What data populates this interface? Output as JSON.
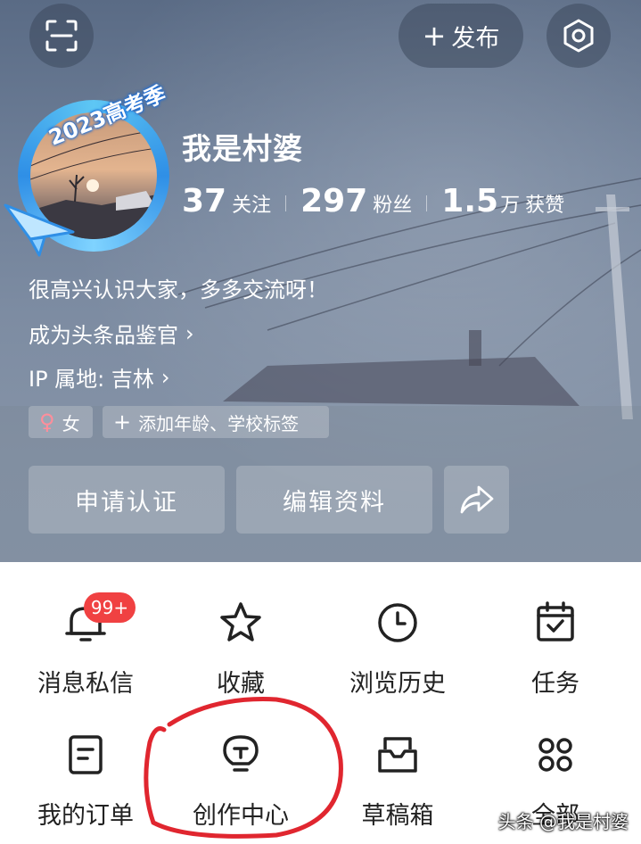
{
  "header": {
    "scan_icon": "scan-icon",
    "publish_label": "发布",
    "settings_icon": "settings-icon"
  },
  "profile": {
    "avatar_badge": "2023高考季",
    "username": "我是村婆",
    "stats": [
      {
        "value": "37",
        "unit": "",
        "label": "关注"
      },
      {
        "value": "297",
        "unit": "",
        "label": "粉丝"
      },
      {
        "value": "1.5",
        "unit": "万",
        "label": "获赞"
      }
    ],
    "bio": "很高兴认识大家，多多交流呀！",
    "appraiser_link": "成为头条品鉴官",
    "ip_location": "IP 属地: 吉林",
    "tags": {
      "gender": "女",
      "add_tags": "添加年龄、学校标签"
    },
    "buttons": {
      "verify": "申请认证",
      "edit": "编辑资料",
      "share_icon": "share-icon"
    }
  },
  "menu": {
    "items": [
      {
        "label": "消息私信",
        "icon": "bell-icon",
        "badge": "99+"
      },
      {
        "label": "收藏",
        "icon": "star-icon"
      },
      {
        "label": "浏览历史",
        "icon": "clock-icon"
      },
      {
        "label": "任务",
        "icon": "calendar-check-icon"
      },
      {
        "label": "我的订单",
        "icon": "order-list-icon"
      },
      {
        "label": "创作中心",
        "icon": "lightbulb-icon"
      },
      {
        "label": "草稿箱",
        "icon": "inbox-icon"
      },
      {
        "label": "全部",
        "icon": "grid-icon"
      }
    ]
  },
  "watermark": "头条 @我是村婆",
  "colors": {
    "badge_red": "#f04142",
    "annotation_red": "#e0262f",
    "female_pink": "#ff8e9b"
  }
}
